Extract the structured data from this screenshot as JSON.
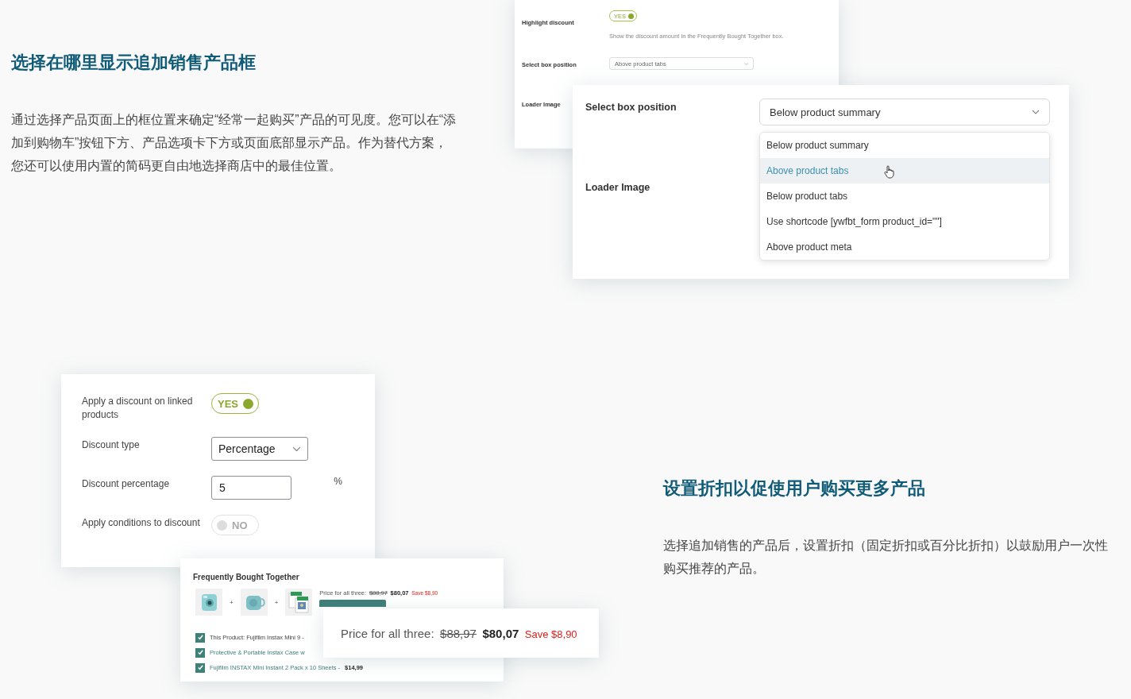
{
  "position_section": {
    "heading": "选择在哪里显示追加销售产品框",
    "body": "通过选择产品页面上的框位置来确定“经常一起购买”产品的可见度。您可以在“添加到购物车”按钮下方、产品选项卡下方或页面底部显示产品。作为替代方案，您还可以使用内置的简码更自由地选择商店中的最佳位置。"
  },
  "back_settings": {
    "highlight_label": "Highlight discount",
    "highlight_toggle": {
      "label": "YES",
      "on": true
    },
    "highlight_help": "Show the discount amount in the Frequently Bought Together box.",
    "position_label": "Select box position",
    "position_value": "Above product tabs",
    "loader_label": "Loader Image"
  },
  "front_settings": {
    "position_label": "Select box position",
    "position_value": "Below product summary",
    "loader_label": "Loader Image",
    "options": [
      {
        "label": "Below product summary",
        "selected": false
      },
      {
        "label": "Above product tabs",
        "selected": true
      },
      {
        "label": "Below product tabs",
        "selected": false
      },
      {
        "label": "Use shortcode [ywfbt_form product_id=\"\"]",
        "selected": false
      },
      {
        "label": "Above product meta",
        "selected": false
      }
    ]
  },
  "discount_settings": {
    "rows": [
      {
        "kind": "toggle",
        "label": "Apply a discount on linked products",
        "value": "YES",
        "on": true
      },
      {
        "kind": "select",
        "label": "Discount type",
        "value": "Percentage"
      },
      {
        "kind": "number",
        "label": "Discount percentage",
        "value": "5",
        "unit": "%"
      },
      {
        "kind": "toggle",
        "label": "Apply conditions to discount",
        "value": "NO",
        "on": false
      }
    ]
  },
  "bought_together": {
    "title": "Frequently Bought Together",
    "plus_signs": [
      "+",
      "+"
    ],
    "price_label": "Price for all three:",
    "old_price": "$88,97",
    "new_price": "$80,07",
    "saving": "Save $8,90",
    "items": [
      {
        "label": "This Product: Fujifilm Instax Mini 9 -",
        "checked": true
      },
      {
        "label": "Protective & Portable Instax Case w",
        "checked": true
      },
      {
        "label": "Fujifilm INSTAX Mini Instant 2 Pack x 10 Sheets -",
        "price": "$14,99",
        "checked": true
      }
    ]
  },
  "price_callout": {
    "price_label": "Price for all three:",
    "old_price": "$88,97",
    "new_price": "$80,07",
    "saving": "Save $8,90"
  },
  "discount_section": {
    "heading": "设置折扣以促使用户购买更多产品",
    "body": "选择追加销售的产品后，设置折扣（固定折扣或百分比折扣）以鼓励用户一次性购买推荐的产品。"
  }
}
